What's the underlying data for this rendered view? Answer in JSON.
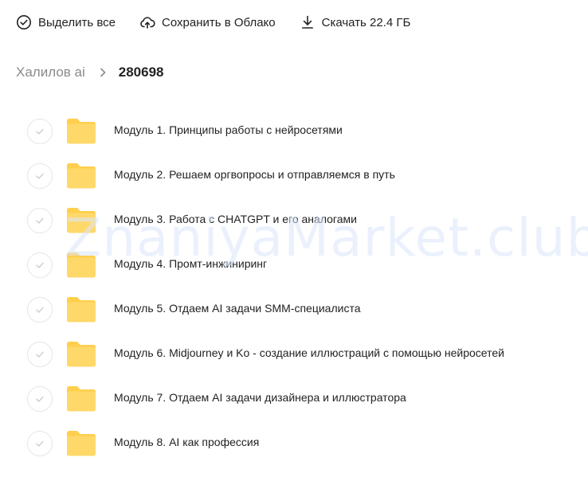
{
  "toolbar": {
    "select_all": {
      "label": "Выделить все",
      "icon": "check-circle-icon"
    },
    "save_cloud": {
      "label": "Сохранить в Облако",
      "icon": "cloud-upload-icon"
    },
    "download": {
      "label": "Скачать 22.4 ГБ",
      "icon": "download-icon"
    }
  },
  "breadcrumb": {
    "parent": "Халилов ai",
    "current": "280698"
  },
  "files": [
    {
      "name": "Модуль 1. Принципы работы с нейросетями",
      "type": "folder"
    },
    {
      "name": "Модуль 2. Решаем оргвопросы и отправляемся в путь",
      "type": "folder"
    },
    {
      "name": "Модуль 3. Работа с CHATGPT и его аналогами",
      "type": "folder"
    },
    {
      "name": "Модуль 4. Промт-инжиниринг",
      "type": "folder"
    },
    {
      "name": "Модуль 5. Отдаем AI задачи SMM-специалиста",
      "type": "folder"
    },
    {
      "name": "Модуль 6. Midjourney и Ko - создание иллюстраций с помощью нейросетей",
      "type": "folder"
    },
    {
      "name": "Модуль 7. Отдаем AI задачи дизайнера и иллюстратора",
      "type": "folder"
    },
    {
      "name": "Модуль 8. AI как профессия",
      "type": "folder"
    }
  ],
  "colors": {
    "folder": "#ffd86a",
    "folder_tab": "#ffcf4d",
    "muted_text": "#8a8a8a",
    "watermark": "#dbe7fb"
  },
  "watermark": "ZnaniyaMarket.club"
}
